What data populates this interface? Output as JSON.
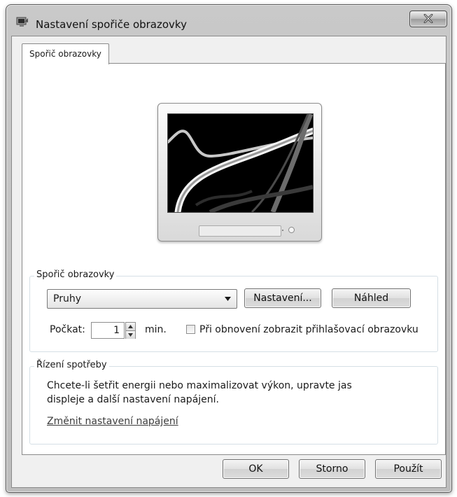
{
  "window": {
    "title": "Nastavení spořiče obrazovky"
  },
  "tabs": [
    {
      "label": "Spořič obrazovky",
      "selected": true
    }
  ],
  "preview": {
    "screensaver_image": "ribbons-screensaver-preview"
  },
  "screensaver_group": {
    "legend": "Spořič obrazovky",
    "selected": "Pruhy",
    "settings_button": "Nastavení...",
    "preview_button": "Náhled",
    "wait_label": "Počkat:",
    "wait_value": "1",
    "wait_unit": "min.",
    "resume_checkbox": {
      "label": "Při obnovení zobrazit přihlašovací obrazovku",
      "checked": false
    }
  },
  "power_group": {
    "legend": "Řízení spotřeby",
    "description_line1": "Chcete-li šetřit energii nebo maximalizovat výkon, upravte jas",
    "description_line2": "displeje a další nastavení napájení.",
    "link": "Změnit nastavení napájení"
  },
  "footer": {
    "ok": "OK",
    "cancel": "Storno",
    "apply": "Použít"
  },
  "icons": {
    "app": "screensaver-settings-icon",
    "close": "close-icon",
    "dropdown": "chevron-down-icon",
    "spin_up": "arrow-up-icon",
    "spin_down": "arrow-down-icon"
  }
}
